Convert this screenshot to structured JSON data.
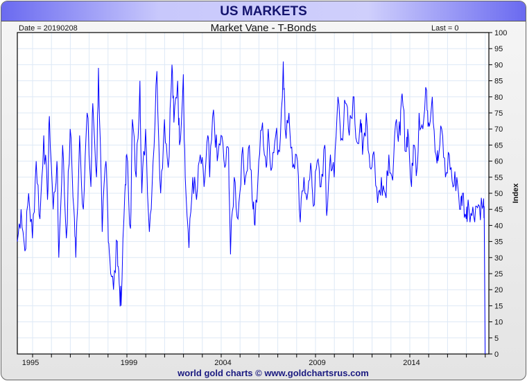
{
  "header": {
    "title": "US MARKETS"
  },
  "footer": {
    "credit": "world gold charts © www.goldchartsrus.com"
  },
  "chart_data": {
    "type": "line",
    "title": "Market Vane - T-Bonds",
    "date_label": "Date = 20190208",
    "last_label": "Last = 0",
    "ylabel": "Index",
    "ylim": [
      0,
      100
    ],
    "yticks": [
      0,
      5,
      10,
      15,
      20,
      25,
      30,
      35,
      40,
      45,
      50,
      55,
      60,
      65,
      70,
      75,
      80,
      85,
      90,
      95,
      100
    ],
    "xlim": [
      1994.3,
      2019.3
    ],
    "xticks": [
      {
        "label": "1995",
        "at": 1995.0
      },
      {
        "label": "1999",
        "at": 2000.22
      },
      {
        "label": "2004",
        "at": 2005.2
      },
      {
        "label": "2009",
        "at": 2010.2
      },
      {
        "label": "2014",
        "at": 2015.2
      }
    ],
    "grid": true,
    "color": "#0000ff",
    "series": [
      {
        "name": "Market Vane T-Bonds",
        "points": [
          [
            1994.3,
            35
          ],
          [
            1994.5,
            45
          ],
          [
            1994.7,
            32
          ],
          [
            1994.9,
            50
          ],
          [
            1995.1,
            36
          ],
          [
            1995.3,
            60
          ],
          [
            1995.5,
            42
          ],
          [
            1995.7,
            68
          ],
          [
            1995.9,
            48
          ],
          [
            1996.0,
            74
          ],
          [
            1996.2,
            45
          ],
          [
            1996.4,
            60
          ],
          [
            1996.5,
            30
          ],
          [
            1996.7,
            65
          ],
          [
            1996.9,
            36
          ],
          [
            1997.1,
            70
          ],
          [
            1997.3,
            45
          ],
          [
            1997.4,
            30
          ],
          [
            1997.6,
            68
          ],
          [
            1997.8,
            45
          ],
          [
            1998.0,
            75
          ],
          [
            1998.2,
            52
          ],
          [
            1998.3,
            78
          ],
          [
            1998.5,
            55
          ],
          [
            1998.6,
            89
          ],
          [
            1998.8,
            38
          ],
          [
            1999.0,
            60
          ],
          [
            1999.1,
            42
          ],
          [
            1999.2,
            30
          ],
          [
            1999.4,
            20
          ],
          [
            1999.6,
            35
          ],
          [
            1999.7,
            22
          ],
          [
            1999.8,
            15
          ],
          [
            2000.0,
            50
          ],
          [
            2000.1,
            62
          ],
          [
            2000.3,
            39
          ],
          [
            2000.4,
            73
          ],
          [
            2000.6,
            55
          ],
          [
            2000.8,
            85
          ],
          [
            2000.9,
            50
          ],
          [
            2001.1,
            70
          ],
          [
            2001.3,
            38
          ],
          [
            2001.5,
            60
          ],
          [
            2001.7,
            88
          ],
          [
            2001.9,
            50
          ],
          [
            2002.1,
            73
          ],
          [
            2002.3,
            58
          ],
          [
            2002.5,
            90
          ],
          [
            2002.6,
            72
          ],
          [
            2002.8,
            85
          ],
          [
            2002.9,
            65
          ],
          [
            2003.1,
            87
          ],
          [
            2003.2,
            55
          ],
          [
            2003.4,
            33
          ],
          [
            2003.6,
            55
          ],
          [
            2003.8,
            48
          ],
          [
            2004.0,
            62
          ],
          [
            2004.2,
            52
          ],
          [
            2004.4,
            68
          ],
          [
            2004.5,
            55
          ],
          [
            2004.7,
            76
          ],
          [
            2004.9,
            60
          ],
          [
            2005.1,
            68
          ],
          [
            2005.3,
            58
          ],
          [
            2005.5,
            64
          ],
          [
            2005.6,
            31
          ],
          [
            2005.8,
            55
          ],
          [
            2006.0,
            42
          ],
          [
            2006.2,
            62
          ],
          [
            2006.4,
            55
          ],
          [
            2006.6,
            65
          ],
          [
            2006.8,
            45
          ],
          [
            2006.9,
            40
          ],
          [
            2007.1,
            60
          ],
          [
            2007.3,
            72
          ],
          [
            2007.5,
            58
          ],
          [
            2007.6,
            70
          ],
          [
            2007.8,
            58
          ],
          [
            2008.0,
            68
          ],
          [
            2008.2,
            63
          ],
          [
            2008.4,
            91
          ],
          [
            2008.5,
            70
          ],
          [
            2008.7,
            75
          ],
          [
            2008.9,
            58
          ],
          [
            2009.1,
            62
          ],
          [
            2009.3,
            41
          ],
          [
            2009.5,
            55
          ],
          [
            2009.7,
            50
          ],
          [
            2009.9,
            57
          ],
          [
            2010.0,
            46
          ],
          [
            2010.2,
            60
          ],
          [
            2010.4,
            52
          ],
          [
            2010.6,
            65
          ],
          [
            2010.7,
            43
          ],
          [
            2010.9,
            62
          ],
          [
            2011.1,
            55
          ],
          [
            2011.3,
            80
          ],
          [
            2011.5,
            67
          ],
          [
            2011.7,
            78
          ],
          [
            2011.9,
            68
          ],
          [
            2012.1,
            80
          ],
          [
            2012.3,
            66
          ],
          [
            2012.5,
            73
          ],
          [
            2012.6,
            62
          ],
          [
            2012.8,
            75
          ],
          [
            2013.0,
            58
          ],
          [
            2013.2,
            63
          ],
          [
            2013.4,
            47
          ],
          [
            2013.6,
            55
          ],
          [
            2013.8,
            50
          ],
          [
            2014.0,
            62
          ],
          [
            2014.2,
            54
          ],
          [
            2014.4,
            73
          ],
          [
            2014.6,
            68
          ],
          [
            2014.7,
            81
          ],
          [
            2014.9,
            63
          ],
          [
            2015.0,
            70
          ],
          [
            2015.2,
            52
          ],
          [
            2015.3,
            65
          ],
          [
            2015.5,
            58
          ],
          [
            2015.6,
            75
          ],
          [
            2015.8,
            70
          ],
          [
            2016.0,
            82
          ],
          [
            2016.1,
            72
          ],
          [
            2016.3,
            80
          ],
          [
            2016.5,
            62
          ],
          [
            2016.6,
            60
          ],
          [
            2016.8,
            70
          ],
          [
            2017.0,
            55
          ],
          [
            2017.2,
            62
          ],
          [
            2017.4,
            52
          ],
          [
            2017.6,
            55
          ],
          [
            2017.8,
            45
          ],
          [
            2017.9,
            50
          ],
          [
            2018.1,
            42
          ],
          [
            2018.2,
            48
          ],
          [
            2018.4,
            43
          ],
          [
            2018.6,
            46
          ],
          [
            2018.8,
            46
          ],
          [
            2019.0,
            46
          ],
          [
            2019.05,
            46
          ],
          [
            2019.1,
            0
          ]
        ]
      }
    ]
  }
}
